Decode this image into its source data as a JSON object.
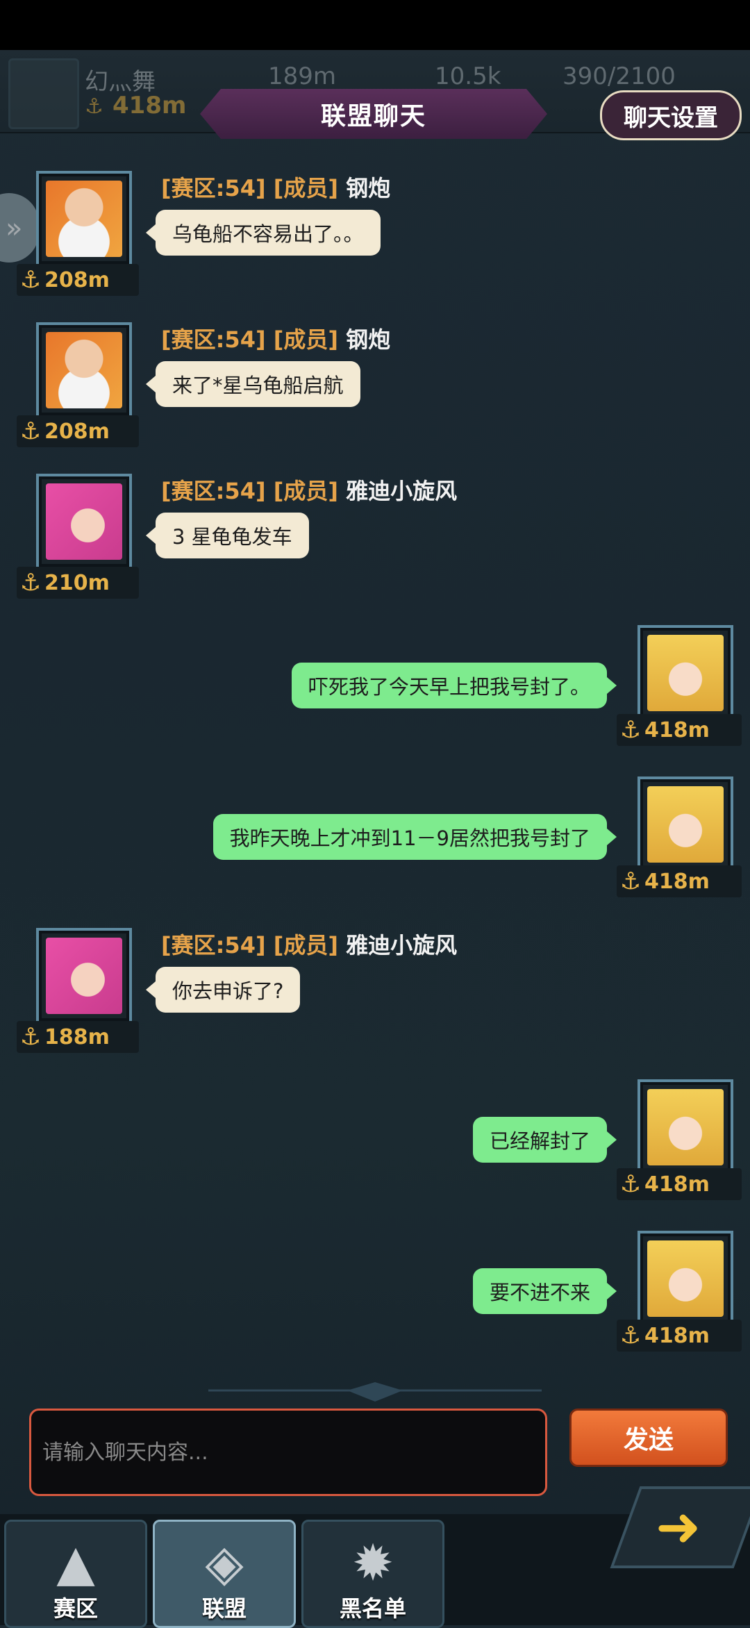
{
  "topbar": {
    "player_name": "幻灬舞",
    "player_distance": "418m",
    "resources": [
      "189m",
      "10.5k",
      "390/2100"
    ]
  },
  "header": {
    "title": "联盟聊天",
    "settings_label": "聊天设置"
  },
  "messages": [
    {
      "side": "other",
      "tag": "[赛区:54] [成员]",
      "name": "钢炮",
      "text": "乌龟船不容易出了。。",
      "distance": "208m",
      "avatar": "old-man-sunglasses-avatar"
    },
    {
      "side": "other",
      "tag": "[赛区:54] [成员]",
      "name": "钢炮",
      "text": "来了*星乌龟船启航",
      "distance": "208m",
      "avatar": "old-man-sunglasses-avatar"
    },
    {
      "side": "other",
      "tag": "[赛区:54] [成员]",
      "name": "雅迪小旋风",
      "text": "3  星龟龟发车",
      "distance": "210m",
      "avatar": "pink-hair-girl-avatar"
    },
    {
      "side": "mine",
      "text": "吓死我了今天早上把我号封了。",
      "distance": "418m",
      "avatar": "blonde-maid-avatar"
    },
    {
      "side": "mine",
      "text": "我昨天晚上才冲到11－9居然把我号封了",
      "distance": "418m",
      "avatar": "blonde-maid-avatar"
    },
    {
      "side": "other",
      "tag": "[赛区:54] [成员]",
      "name": "雅迪小旋风",
      "text": "你去申诉了?",
      "distance": "188m",
      "avatar": "pink-hair-girl-avatar"
    },
    {
      "side": "mine",
      "text": "已经解封了",
      "distance": "418m",
      "avatar": "blonde-maid-avatar"
    },
    {
      "side": "mine",
      "text": "要不进不来",
      "distance": "418m",
      "avatar": "blonde-maid-avatar"
    }
  ],
  "composer": {
    "placeholder": "请输入聊天内容...",
    "send_label": "发送"
  },
  "nav": {
    "tabs": [
      {
        "label": "赛区",
        "icon": "triangle-emblem-icon"
      },
      {
        "label": "联盟",
        "icon": "banner-emblem-icon"
      },
      {
        "label": "黑名单",
        "icon": "spiky-head-icon"
      }
    ],
    "active": "联盟"
  },
  "colors": {
    "accent_gold": "#e7b34a",
    "my_bubble": "#7eeb8e",
    "other_bubble": "#f3ead4",
    "send_button": "#e5662e",
    "title_banner": "#4b2750"
  }
}
